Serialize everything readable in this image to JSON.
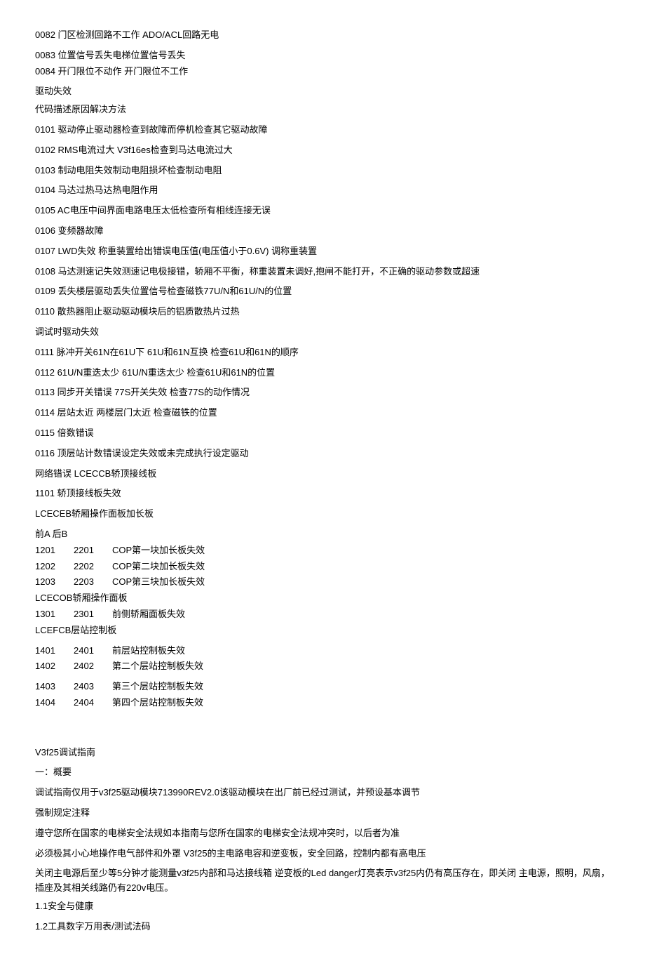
{
  "lines": [
    {
      "text": "0082 门区检测回路不工作  ADO/ACL回路无电",
      "cls": "line"
    },
    {
      "text": "0083 位置信号丢失电梯位置信号丢失",
      "cls": "line section-gap line-tight"
    },
    {
      "text": "0084 开门限位不动作 开门限位不工作",
      "cls": "line"
    },
    {
      "text": "驱动失效",
      "cls": "line section-gap"
    },
    {
      "text": "代码描述原因解决方法",
      "cls": "line"
    },
    {
      "text": "0101 驱动停止驱动器检查到故障而停机检查其它驱动故障",
      "cls": "line section-gap"
    },
    {
      "text": "0102 RMS电流过大  V3f16es检查到马达电流过大",
      "cls": "line section-gap"
    },
    {
      "text": "0103 制动电阻失效制动电阻损坏检查制动电阻",
      "cls": "line section-gap"
    },
    {
      "text": "0104 马达过热马达热电阻作用",
      "cls": "line section-gap"
    },
    {
      "text": "0105 AC电压中间界面电路电压太低检查所有相线连接无误",
      "cls": "line section-gap"
    },
    {
      "text": "0106 变频器故障",
      "cls": "line section-gap"
    },
    {
      "text": "0107 LWD失效  称重装置给出错误电压值(电压值小于0.6V)  调称重装置",
      "cls": "line section-gap"
    },
    {
      "text": "0108 马达测速记失效测速记电极接错，轿厢不平衡，称重装置未调好,抱闸不能打开，不正确的驱动参数或超速",
      "cls": "line section-gap"
    },
    {
      "text": "0109 丢失楼层驱动丢失位置信号检查磁铁77U/N和61U/N的位置",
      "cls": "line section-gap"
    },
    {
      "text": "0110 散热器阻止驱动驱动模块后的铝质散热片过热",
      "cls": "line section-gap"
    },
    {
      "text": "调试时驱动失效",
      "cls": "line section-gap"
    },
    {
      "text": "0111 脉冲开关61N在61U下  61U和61N互换 检查61U和61N的顺序",
      "cls": "line section-gap"
    },
    {
      "text": "0112     61U/N重迭太少 61U/N重迭太少 检查61U和61N的位置",
      "cls": "line section-gap"
    },
    {
      "text": "0113 同步开关错误 77S开关失效 检查77S的动作情况",
      "cls": "line section-gap"
    },
    {
      "text": "0114 层站太近 两楼层门太近 检查磁铁的位置",
      "cls": "line section-gap"
    },
    {
      "text": "0115 倍数错误",
      "cls": "line section-gap"
    },
    {
      "text": "0116 顶层站计数错误设定失效或未完成执行设定驱动",
      "cls": "line section-gap"
    },
    {
      "text": "网络错误  LCECCB轿顶接线板",
      "cls": "line section-gap"
    },
    {
      "text": "1101 轿顶接线板失效",
      "cls": "line section-gap"
    },
    {
      "text": "LCECEB轿厢操作面板加长板",
      "cls": "line section-gap"
    },
    {
      "text": "前A    后B",
      "cls": "line section-gap line-tight"
    }
  ],
  "table1": [
    {
      "c1": "1201",
      "c2": "2201",
      "c3": "COP第一块加长板失效"
    },
    {
      "c1": "1202",
      "c2": "2202",
      "c3": "COP第二块加长板失效"
    },
    {
      "c1": "1203",
      "c2": "2203",
      "c3": "COP第三块加长板失效"
    }
  ],
  "mid1": "LCECOB轿厢操作面板",
  "table2": [
    {
      "c1": "1301",
      "c2": "2301",
      "c3": "前侧轿厢面板失效"
    }
  ],
  "mid2": "LCEFCB层站控制板",
  "table3a": [
    {
      "c1": "1401",
      "c2": "2401",
      "c3": "前层站控制板失效"
    },
    {
      "c1": "1402",
      "c2": "2402",
      "c3": "第二个层站控制板失效"
    }
  ],
  "table3b": [
    {
      "c1": "1403",
      "c2": "2403",
      "c3": "第三个层站控制板失效"
    },
    {
      "c1": "1404",
      "c2": "2404",
      "c3": "第四个层站控制板失效"
    }
  ],
  "lines2": [
    {
      "text": "V3f25调试指南",
      "cls": "line big-gap"
    },
    {
      "text": "一：概要",
      "cls": "line section-gap"
    },
    {
      "text": "调试指南仅用于v3f25驱动模块713990REV2.0该驱动模块在出厂前已经过测试，并预设基本调节",
      "cls": "line section-gap"
    },
    {
      "text": "强制规定注释",
      "cls": "line section-gap"
    },
    {
      "text": "遵守您所在国家的电梯安全法规如本指南与您所在国家的电梯安全法规冲突时，以后者为准",
      "cls": "line section-gap"
    },
    {
      "text": "必须极其小心地操作电气部件和外罩  V3f25的主电路电容和逆变板，安全回路，控制内都有高电压",
      "cls": "line section-gap"
    },
    {
      "text": "关闭主电源后至少等5分钟才能测量v3f25内部和马达接线箱  逆变板的Led  danger灯亮表示v3f25内仍有高压存在，即关闭  主电源，照明，风扇，插座及其相关线路仍有220v电压。",
      "cls": "line section-gap"
    },
    {
      "text": "1.1安全与健康",
      "cls": "line"
    },
    {
      "text": "1.2工具数字万用表/测试法码",
      "cls": "line section-gap"
    }
  ]
}
